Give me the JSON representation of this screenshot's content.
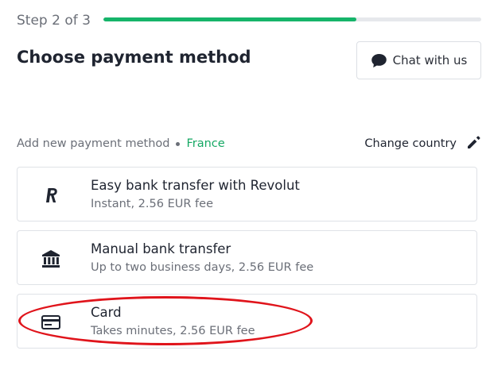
{
  "header": {
    "step_label": "Step 2 of 3",
    "progress_fraction": 0.67,
    "progress_color": "#16b46a",
    "title": "Choose payment method",
    "chat_button": {
      "label": "Chat with us",
      "icon": "chat-bubble-icon"
    }
  },
  "meta": {
    "add_label": "Add new payment method",
    "country": "France",
    "country_color": "#16a864",
    "change_country_label": "Change country",
    "change_icon": "pencil-icon"
  },
  "methods": [
    {
      "title": "Easy bank transfer with Revolut",
      "subtitle": "Instant, 2.56 EUR fee",
      "icon": "revolut-logo-icon"
    },
    {
      "title": "Manual bank transfer",
      "subtitle": "Up to two business days, 2.56 EUR fee",
      "icon": "bank-icon"
    },
    {
      "title": "Card",
      "subtitle": "Takes minutes, 2.56 EUR fee",
      "icon": "credit-card-icon",
      "highlighted": true
    }
  ],
  "annotation": {
    "color": "#e0141b",
    "target": "Card"
  }
}
